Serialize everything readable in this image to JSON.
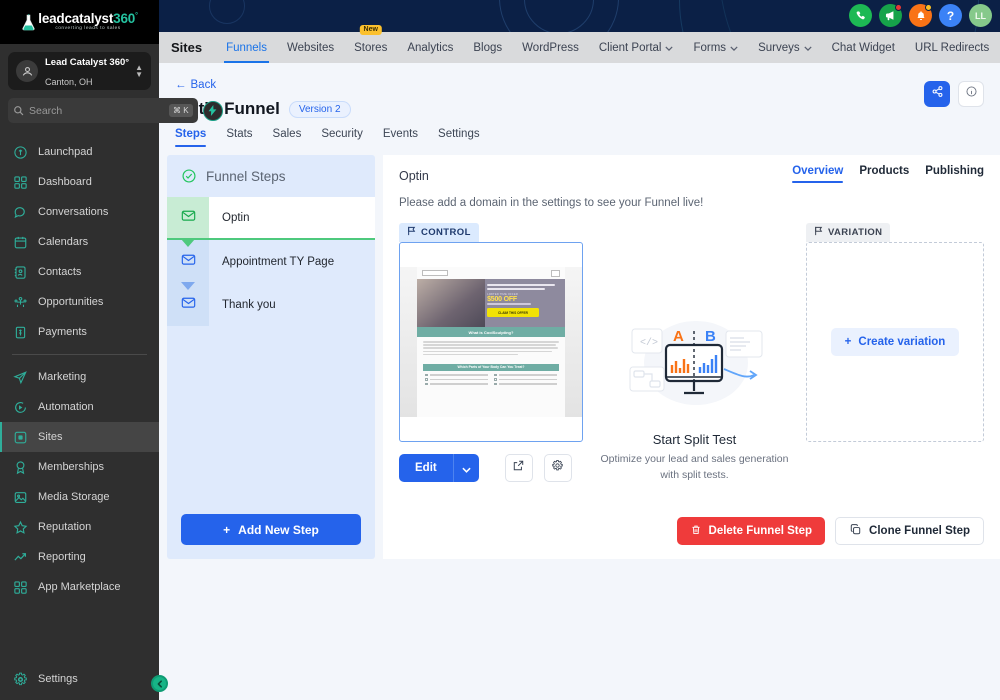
{
  "brand": {
    "name_main": "leadcatalyst",
    "name_accent": "360",
    "degree": "°",
    "tagline": "converting leads to sales"
  },
  "account": {
    "title": "Lead Catalyst 360°",
    "location": "Canton, OH"
  },
  "search": {
    "placeholder": "Search",
    "shortcut": "⌘ K"
  },
  "sidebar": {
    "items": [
      {
        "label": "Launchpad",
        "icon": "rocket-icon"
      },
      {
        "label": "Dashboard",
        "icon": "grid-icon"
      },
      {
        "label": "Conversations",
        "icon": "chat-icon"
      },
      {
        "label": "Calendars",
        "icon": "calendar-icon"
      },
      {
        "label": "Contacts",
        "icon": "contacts-icon"
      },
      {
        "label": "Opportunities",
        "icon": "opportunities-icon"
      },
      {
        "label": "Payments",
        "icon": "payments-icon"
      }
    ],
    "items2": [
      {
        "label": "Marketing",
        "icon": "send-icon"
      },
      {
        "label": "Automation",
        "icon": "automation-icon"
      },
      {
        "label": "Sites",
        "icon": "sites-icon",
        "active": true
      },
      {
        "label": "Memberships",
        "icon": "badge-icon"
      },
      {
        "label": "Media Storage",
        "icon": "image-icon"
      },
      {
        "label": "Reputation",
        "icon": "star-icon"
      },
      {
        "label": "Reporting",
        "icon": "trend-icon"
      },
      {
        "label": "App Marketplace",
        "icon": "apps-icon"
      }
    ],
    "settings_label": "Settings",
    "settings_icon": "gear-icon",
    "collapse_icon": "chevron-left-icon"
  },
  "topbar": {
    "icons": [
      {
        "name": "phone-icon",
        "badge": null
      },
      {
        "name": "megaphone-icon",
        "badge": "red"
      },
      {
        "name": "bell-icon",
        "badge": "orange"
      },
      {
        "name": "help-icon",
        "label": "?"
      },
      {
        "name": "user-avatar",
        "label": "LL"
      }
    ]
  },
  "subnav": {
    "section": "Sites",
    "items": [
      {
        "label": "Funnels",
        "active": true
      },
      {
        "label": "Websites"
      },
      {
        "label": "Stores",
        "badge": "New"
      },
      {
        "label": "Analytics"
      },
      {
        "label": "Blogs"
      },
      {
        "label": "WordPress"
      },
      {
        "label": "Client Portal",
        "caret": true
      },
      {
        "label": "Forms",
        "caret": true
      },
      {
        "label": "Surveys",
        "caret": true
      },
      {
        "label": "Chat Widget"
      },
      {
        "label": "URL Redirects"
      }
    ],
    "gear_icon": "gear-icon"
  },
  "page": {
    "back_label": "Back",
    "title": "Optin Funnel",
    "version_badge": "Version 2",
    "tabs": [
      {
        "label": "Steps",
        "active": true
      },
      {
        "label": "Stats"
      },
      {
        "label": "Sales"
      },
      {
        "label": "Security"
      },
      {
        "label": "Events"
      },
      {
        "label": "Settings"
      }
    ],
    "share_icon": "share-icon",
    "info_icon": "info-icon"
  },
  "steps_panel": {
    "title": "Funnel Steps",
    "status_icon": "check-circle-icon",
    "steps": [
      {
        "label": "Optin",
        "icon": "envelope-icon",
        "selected": true
      },
      {
        "label": "Appointment TY Page",
        "icon": "envelope-icon",
        "selected": false
      },
      {
        "label": "Thank you",
        "icon": "envelope-icon",
        "selected": false
      }
    ],
    "add_button": "Add New Step",
    "add_icon": "plus-icon"
  },
  "main": {
    "step_name": "Optin",
    "tabs": [
      {
        "label": "Overview",
        "active": true
      },
      {
        "label": "Products"
      },
      {
        "label": "Publishing"
      }
    ],
    "domain_note": "Please add a domain in the settings to see your Funnel live!",
    "control": {
      "flag_label": "CONTROL",
      "flag_icon": "flag-icon"
    },
    "variation": {
      "flag_label": "VARIATION",
      "flag_icon": "flag-icon",
      "create_label": "Create variation",
      "create_icon": "plus-icon"
    },
    "split_test": {
      "title": "Start Split Test",
      "description": "Optimize your lead and sales generation with split tests.",
      "illustration_labels": [
        "A",
        "B"
      ]
    },
    "actions": {
      "edit_label": "Edit",
      "edit_caret_icon": "chevron-down-icon",
      "preview_icon": "external-link-icon",
      "settings_icon": "gear-icon",
      "delete_label": "Delete Funnel Step",
      "delete_icon": "trash-icon",
      "clone_label": "Clone Funnel Step",
      "clone_icon": "copy-icon"
    }
  },
  "preview_page": {
    "offer": "$500 OFF",
    "eyebrow": "LIMITED TIME OFFER",
    "cta": "CLAIM THIS OFFER",
    "band": "What is CoolSculpting?",
    "band2": "Which Parts of Your Body Can You Treat?"
  },
  "colors": {
    "accent_blue": "#2563eb",
    "brand_teal": "#25c2a0",
    "danger_red": "#ef3b3b",
    "step_green": "#4ec97d"
  }
}
